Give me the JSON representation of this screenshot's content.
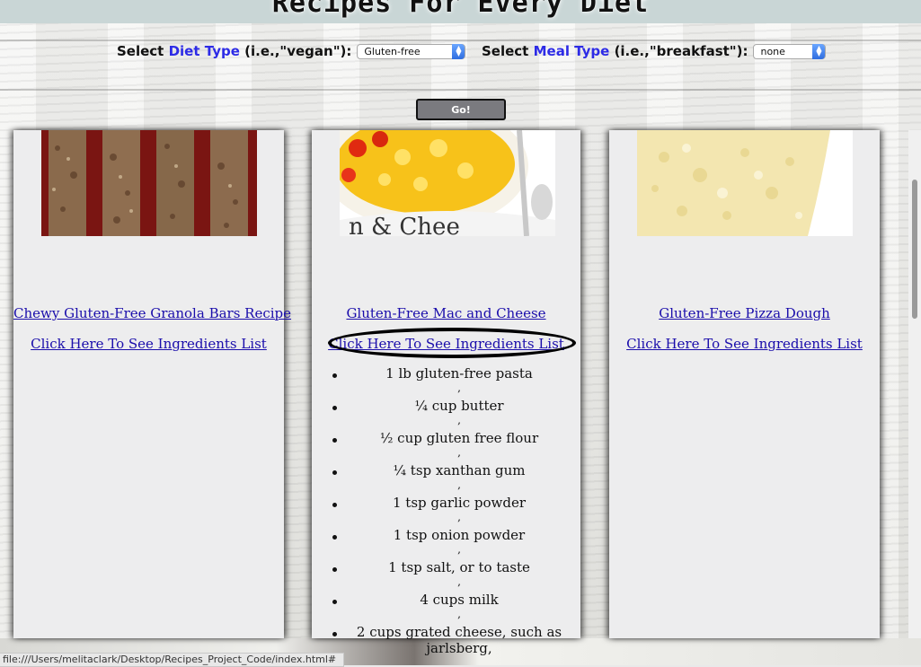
{
  "header": {
    "title": "Recipes For Every Diet"
  },
  "filters": {
    "diet_prefix": "Select",
    "diet_accent": "Diet Type",
    "diet_hint": "(i.e.,\"vegan\"):",
    "diet_value": "Gluten-free",
    "meal_prefix": "Select",
    "meal_accent": "Meal Type",
    "meal_hint": "(i.e.,\"breakfast\"):",
    "meal_value": "none"
  },
  "go_label": "Go!",
  "recipes": [
    {
      "title": "Chewy Gluten-Free Granola Bars Recipe",
      "ingredients_link": "Click Here To See Ingredients List"
    },
    {
      "title": "Gluten-Free Mac and Cheese",
      "ingredients_link": "Click Here To See Ingredients List",
      "ingredients": [
        "1 lb gluten-free pasta",
        "¼ cup butter",
        "½ cup gluten free flour",
        "¼ tsp xanthan gum",
        "1 tsp garlic powder",
        "1 tsp onion powder",
        "1 tsp salt, or to taste",
        "4 cups milk",
        "2 cups grated cheese, such as jarlsberg,"
      ],
      "separator": ","
    },
    {
      "title": "Gluten-Free Pizza Dough",
      "ingredients_link": "Click Here To See Ingredients List"
    }
  ],
  "status_bar": "file:///Users/melitaclark/Desktop/Recipes_Project_Code/index.html#",
  "colors": {
    "accent": "#2d2be6",
    "link": "#1a0dab",
    "go_button": "#7a7a7f"
  }
}
